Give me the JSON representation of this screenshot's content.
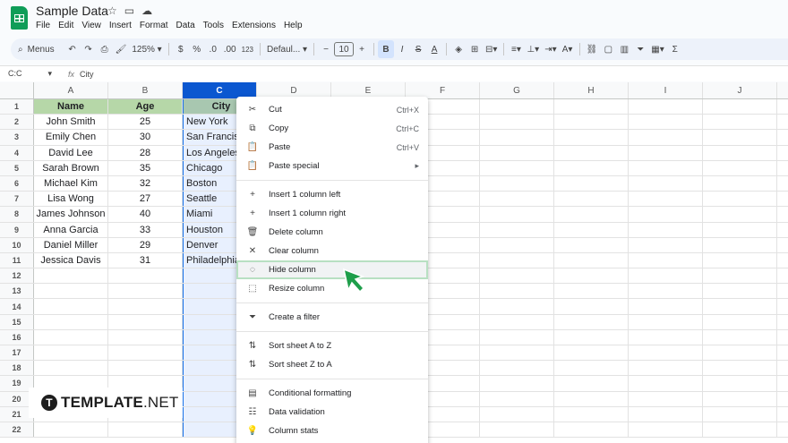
{
  "app": {
    "title": "Sample Data"
  },
  "menubar": [
    "File",
    "Edit",
    "View",
    "Insert",
    "Format",
    "Data",
    "Tools",
    "Extensions",
    "Help"
  ],
  "toolbar": {
    "menus_label": "Menus",
    "zoom": "125%",
    "currency": "$",
    "percent": "%",
    "dec_less": ".0",
    "dec_more": ".00",
    "number_format": "123",
    "font": "Defaul...",
    "font_size": "10",
    "bold": "B"
  },
  "formula_bar": {
    "name_box": "C:C",
    "fx": "fx",
    "content": "City"
  },
  "columns": [
    "A",
    "B",
    "C",
    "D",
    "E",
    "F",
    "G",
    "H",
    "I",
    "J"
  ],
  "active_column": "C",
  "rows": [
    {
      "n": "1",
      "a": "Name",
      "b": "Age",
      "c": "City"
    },
    {
      "n": "2",
      "a": "John Smith",
      "b": "25",
      "c": "New York"
    },
    {
      "n": "3",
      "a": "Emily Chen",
      "b": "30",
      "c": "San Francisco"
    },
    {
      "n": "4",
      "a": "David Lee",
      "b": "28",
      "c": "Los Angeles"
    },
    {
      "n": "5",
      "a": "Sarah Brown",
      "b": "35",
      "c": "Chicago"
    },
    {
      "n": "6",
      "a": "Michael Kim",
      "b": "32",
      "c": "Boston"
    },
    {
      "n": "7",
      "a": "Lisa Wong",
      "b": "27",
      "c": "Seattle"
    },
    {
      "n": "8",
      "a": "James Johnson",
      "b": "40",
      "c": "Miami"
    },
    {
      "n": "9",
      "a": "Anna Garcia",
      "b": "33",
      "c": "Houston"
    },
    {
      "n": "10",
      "a": "Daniel Miller",
      "b": "29",
      "c": "Denver"
    },
    {
      "n": "11",
      "a": "Jessica Davis",
      "b": "31",
      "c": "Philadelphia"
    },
    {
      "n": "12",
      "a": "",
      "b": "",
      "c": ""
    },
    {
      "n": "13",
      "a": "",
      "b": "",
      "c": ""
    },
    {
      "n": "14",
      "a": "",
      "b": "",
      "c": ""
    },
    {
      "n": "15",
      "a": "",
      "b": "",
      "c": ""
    },
    {
      "n": "16",
      "a": "",
      "b": "",
      "c": ""
    },
    {
      "n": "17",
      "a": "",
      "b": "",
      "c": ""
    },
    {
      "n": "18",
      "a": "",
      "b": "",
      "c": ""
    },
    {
      "n": "19",
      "a": "",
      "b": "",
      "c": ""
    },
    {
      "n": "20",
      "a": "",
      "b": "",
      "c": ""
    },
    {
      "n": "21",
      "a": "",
      "b": "",
      "c": ""
    },
    {
      "n": "22",
      "a": "",
      "b": "",
      "c": ""
    }
  ],
  "context_menu": {
    "items": [
      {
        "icon": "scissors-icon",
        "glyph": "✂",
        "label": "Cut",
        "shortcut": "Ctrl+X"
      },
      {
        "icon": "copy-icon",
        "glyph": "⧉",
        "label": "Copy",
        "shortcut": "Ctrl+C"
      },
      {
        "icon": "paste-icon",
        "glyph": "📋",
        "label": "Paste",
        "shortcut": "Ctrl+V"
      },
      {
        "icon": "paste-special-icon",
        "glyph": "📋",
        "label": "Paste special",
        "shortcut": "▸"
      },
      {
        "icon": "plus-icon",
        "glyph": "+",
        "label": "Insert 1 column left",
        "shortcut": ""
      },
      {
        "icon": "plus-icon",
        "glyph": "+",
        "label": "Insert 1 column right",
        "shortcut": ""
      },
      {
        "icon": "trash-icon",
        "glyph": "🗑",
        "label": "Delete column",
        "shortcut": ""
      },
      {
        "icon": "close-icon",
        "glyph": "✕",
        "label": "Clear column",
        "shortcut": ""
      },
      {
        "icon": "eye-off-icon",
        "glyph": "◌",
        "label": "Hide column",
        "shortcut": ""
      },
      {
        "icon": "resize-icon",
        "glyph": "⬚",
        "label": "Resize column",
        "shortcut": ""
      },
      {
        "icon": "filter-icon",
        "glyph": "⏷",
        "label": "Create a filter",
        "shortcut": ""
      },
      {
        "icon": "sort-az-icon",
        "glyph": "⇅",
        "label": "Sort sheet A to Z",
        "shortcut": ""
      },
      {
        "icon": "sort-za-icon",
        "glyph": "⇅",
        "label": "Sort sheet Z to A",
        "shortcut": ""
      },
      {
        "icon": "conditional-format-icon",
        "glyph": "▤",
        "label": "Conditional formatting",
        "shortcut": ""
      },
      {
        "icon": "data-validation-icon",
        "glyph": "☷",
        "label": "Data validation",
        "shortcut": ""
      },
      {
        "icon": "bulb-icon",
        "glyph": "💡",
        "label": "Column stats",
        "shortcut": ""
      }
    ]
  },
  "brand": {
    "mark": "T",
    "bold": "TEMPLATE",
    "thin": ".NET"
  },
  "colors": {
    "header_fill": "#b6d7a8",
    "selection": "#e8f0fe",
    "accent": "#0b57d0",
    "cursor": "#1e9e4a"
  }
}
